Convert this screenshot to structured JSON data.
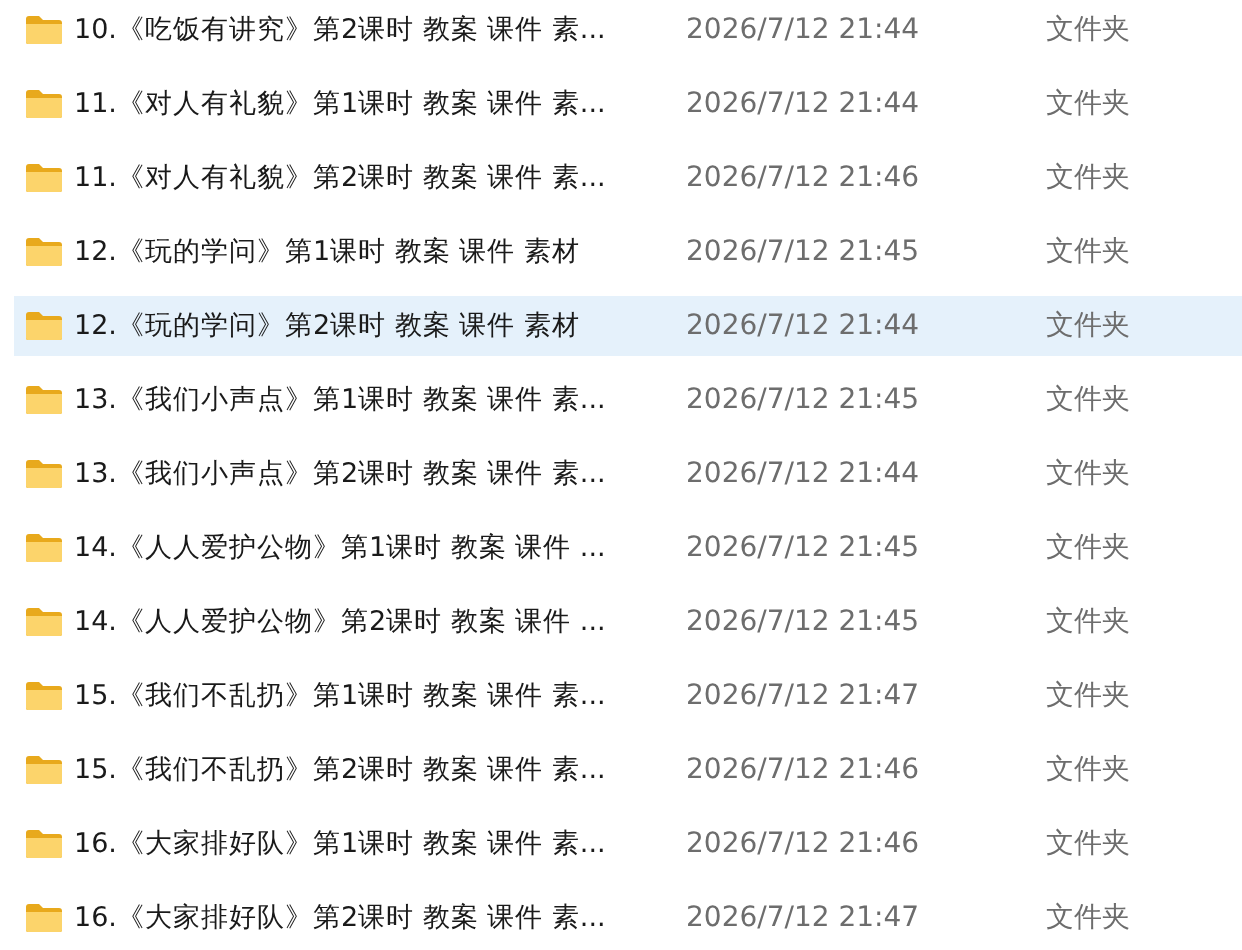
{
  "files": [
    {
      "name": "10.《吃饭有讲究》第2课时 教案 课件 素...",
      "modified": "2026/7/12 21:44",
      "type": "文件夹",
      "selected": false
    },
    {
      "name": "11.《对人有礼貌》第1课时 教案 课件 素...",
      "modified": "2026/7/12 21:44",
      "type": "文件夹",
      "selected": false
    },
    {
      "name": "11.《对人有礼貌》第2课时 教案 课件 素...",
      "modified": "2026/7/12 21:46",
      "type": "文件夹",
      "selected": false
    },
    {
      "name": "12.《玩的学问》第1课时 教案 课件 素材",
      "modified": "2026/7/12 21:45",
      "type": "文件夹",
      "selected": false
    },
    {
      "name": "12.《玩的学问》第2课时 教案 课件 素材",
      "modified": "2026/7/12 21:44",
      "type": "文件夹",
      "selected": true
    },
    {
      "name": "13.《我们小声点》第1课时 教案 课件 素...",
      "modified": "2026/7/12 21:45",
      "type": "文件夹",
      "selected": false
    },
    {
      "name": "13.《我们小声点》第2课时 教案 课件 素...",
      "modified": "2026/7/12 21:44",
      "type": "文件夹",
      "selected": false
    },
    {
      "name": "14.《人人爱护公物》第1课时 教案 课件 ...",
      "modified": "2026/7/12 21:45",
      "type": "文件夹",
      "selected": false
    },
    {
      "name": "14.《人人爱护公物》第2课时 教案 课件 ...",
      "modified": "2026/7/12 21:45",
      "type": "文件夹",
      "selected": false
    },
    {
      "name": "15.《我们不乱扔》第1课时 教案 课件 素...",
      "modified": "2026/7/12 21:47",
      "type": "文件夹",
      "selected": false
    },
    {
      "name": "15.《我们不乱扔》第2课时 教案 课件 素...",
      "modified": "2026/7/12 21:46",
      "type": "文件夹",
      "selected": false
    },
    {
      "name": "16.《大家排好队》第1课时 教案 课件 素...",
      "modified": "2026/7/12 21:46",
      "type": "文件夹",
      "selected": false
    },
    {
      "name": "16.《大家排好队》第2课时 教案 课件 素...",
      "modified": "2026/7/12 21:47",
      "type": "文件夹",
      "selected": false
    }
  ]
}
